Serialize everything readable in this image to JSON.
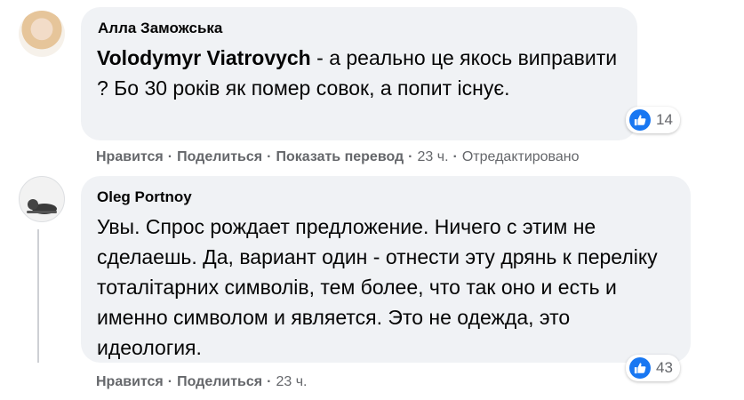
{
  "comments": [
    {
      "author": "Алла Заможська",
      "mention": "Volodymyr Viatrovych",
      "text": " - а реально це якось виправити ? Бо 30 років як помер совок, а попит існує.",
      "reaction_count": "14",
      "actions": {
        "like": "Нравится",
        "share": "Поделиться",
        "translate": "Показать перевод",
        "time": "23 ч.",
        "edited": "Отредактировано"
      }
    },
    {
      "author": "Oleg Portnoy",
      "text": "Увы. Спрос рождает предложение. Ничего с этим не сделаешь. Да, вариант один - отнести эту дрянь к переліку тоталітарних символів, тем более, что так оно и есть и именно символом и является. Это не одежда, это идеология.",
      "reaction_count": "43",
      "actions": {
        "like": "Нравится",
        "share": "Поделиться",
        "time": "23 ч."
      }
    }
  ],
  "icons": {
    "reaction": "like-icon",
    "reaction_color": "#1877f2"
  }
}
